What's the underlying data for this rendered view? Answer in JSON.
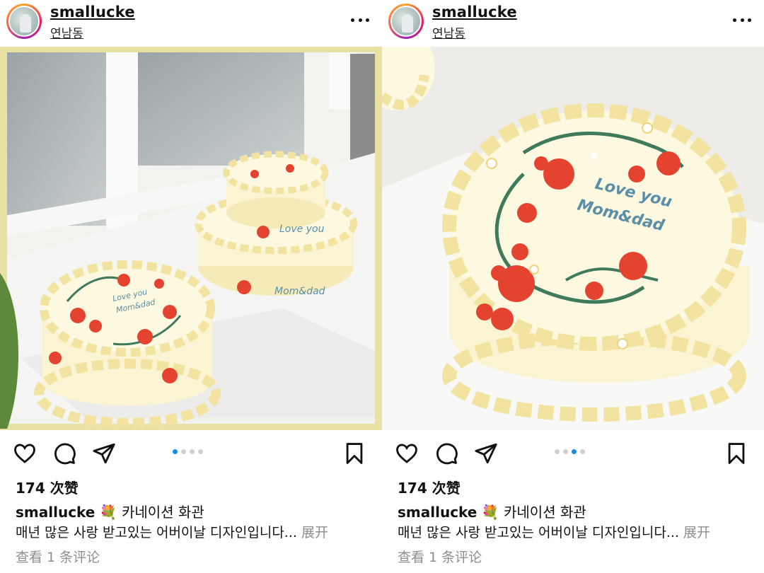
{
  "posts": [
    {
      "username": "smallucke",
      "location": "연남동",
      "likes": "174 次赞",
      "caption_user": "smallucke",
      "caption_emoji": "💐",
      "caption_title": "카네이션 화관",
      "caption_body": "매년 많은 사랑 받고있는 어버이날 디자인입니다...",
      "expand_label": "展开",
      "view_comments": "查看 1 条评论",
      "cake_text_line1": "Love you",
      "cake_text_line2": "Mom&dad",
      "carousel_active_index": 0,
      "carousel_count": 4
    },
    {
      "username": "smallucke",
      "location": "연남동",
      "likes": "174 次赞",
      "caption_user": "smallucke",
      "caption_emoji": "💐",
      "caption_title": "카네이션 화관",
      "caption_body": "매년 많은 사랑 받고있는 어버이날 디자인입니다...",
      "expand_label": "展开",
      "view_comments": "查看 1 条评论",
      "cake_text_line1": "Love you",
      "cake_text_line2": "Mom&dad",
      "carousel_active_index": 2,
      "carousel_count": 4
    }
  ],
  "icons": [
    "heart-icon",
    "comment-icon",
    "share-icon",
    "bookmark-icon",
    "more-icon"
  ],
  "colors": {
    "carousel_active": "#1e88e5",
    "cream": "#f7eec0",
    "flower_red": "#e4432f",
    "leaf_green": "#3f7a5c",
    "text_blue": "#5b8fa8"
  }
}
